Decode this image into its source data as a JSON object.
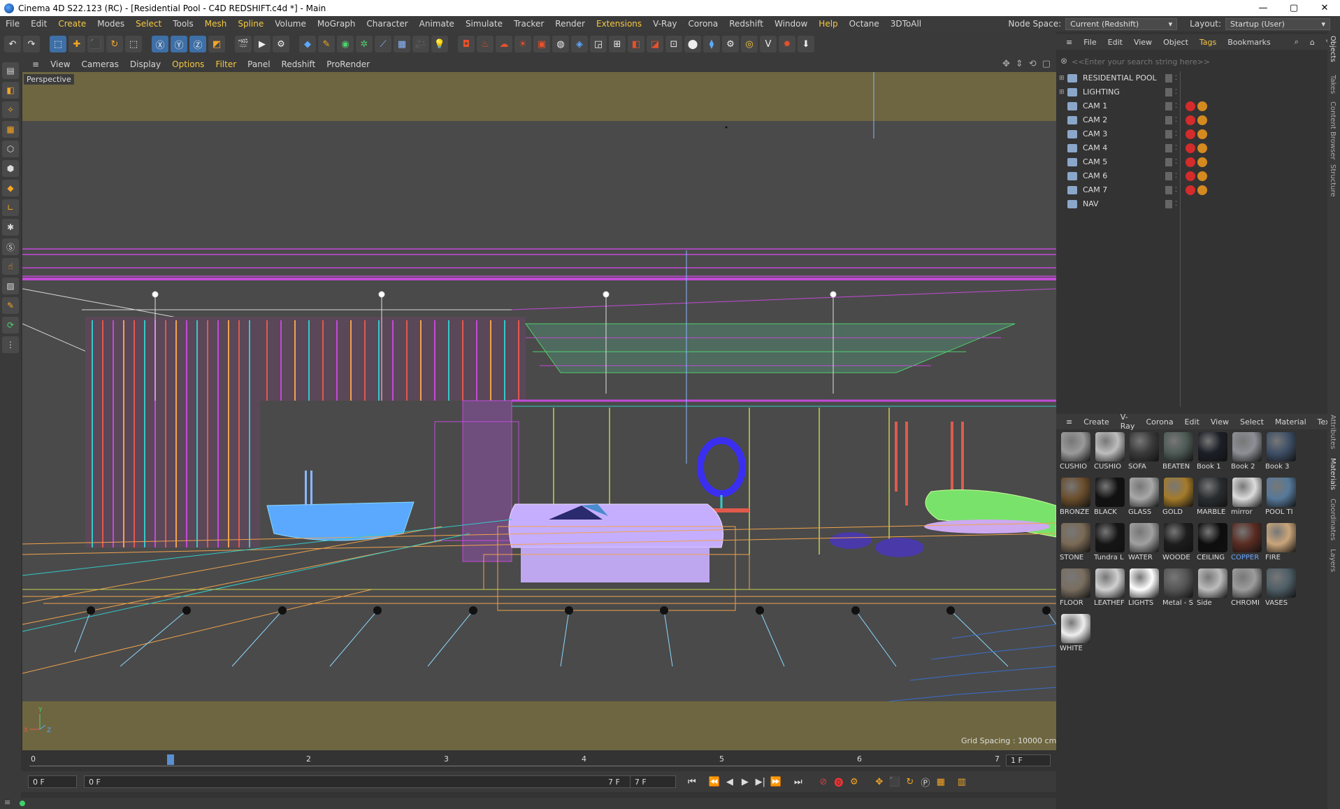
{
  "window": {
    "title": "Cinema 4D S22.123 (RC) - [Residential Pool - C4D REDSHIFT.c4d *] - Main",
    "buttons": [
      "—",
      "▢",
      "✕"
    ]
  },
  "menubar": {
    "items": [
      "File",
      "Edit",
      "Create",
      "Modes",
      "Select",
      "Tools",
      "Mesh",
      "Spline",
      "Volume",
      "MoGraph",
      "Character",
      "Animate",
      "Simulate",
      "Tracker",
      "Render",
      "Extensions",
      "V-Ray",
      "Corona",
      "Redshift",
      "Window",
      "Help",
      "Octane",
      "3DToAll"
    ],
    "node_space_label": "Node Space:",
    "node_space_value": "Current (Redshift)",
    "layout_label": "Layout:",
    "layout_value": "Startup (User)"
  },
  "viewport_menu": {
    "items": [
      "View",
      "Cameras",
      "Display",
      "Options",
      "Filter",
      "Panel",
      "Redshift",
      "ProRender"
    ]
  },
  "viewport": {
    "label": "Perspective",
    "grid_spacing": "Grid Spacing : 10000 cm"
  },
  "timeline": {
    "ticks": [
      "0",
      "1",
      "2",
      "3",
      "4",
      "5",
      "6",
      "7"
    ],
    "current_frame": "1 F"
  },
  "transport": {
    "start_frame": "0 F",
    "min_frame": "0 F",
    "end_frame": "7 F",
    "max_frame": "7 F"
  },
  "object_manager": {
    "menu": [
      "File",
      "Edit",
      "View",
      "Object",
      "Tags",
      "Bookmarks"
    ],
    "search_placeholder": "<<Enter your search string here>>",
    "objects": [
      {
        "name": "RESIDENTIAL POOL",
        "tags": []
      },
      {
        "name": "LIGHTING",
        "tags": []
      },
      {
        "name": "CAM 1",
        "tags": [
          "red",
          "orange"
        ]
      },
      {
        "name": "CAM 2",
        "tags": [
          "red",
          "orange"
        ]
      },
      {
        "name": "CAM 3",
        "tags": [
          "red",
          "orange"
        ]
      },
      {
        "name": "CAM 4",
        "tags": [
          "red",
          "orange"
        ]
      },
      {
        "name": "CAM 5",
        "tags": [
          "red",
          "orange"
        ]
      },
      {
        "name": "CAM 6",
        "tags": [
          "red",
          "orange"
        ]
      },
      {
        "name": "CAM 7",
        "tags": [
          "red",
          "orange"
        ]
      },
      {
        "name": "NAV",
        "tags": []
      }
    ]
  },
  "material_manager": {
    "menu": [
      "Create",
      "V-Ray",
      "Corona",
      "Edit",
      "View",
      "Select",
      "Material",
      "Textu"
    ],
    "materials": [
      {
        "name": "CUSHIO",
        "color": "#9a9a9a"
      },
      {
        "name": "CUSHIO",
        "color": "#bdbdbd"
      },
      {
        "name": "SOFA",
        "color": "#3a3a3a"
      },
      {
        "name": "BEATEN",
        "color": "#4d5a55"
      },
      {
        "name": "Book 1",
        "color": "#1c1f27"
      },
      {
        "name": "Book 2",
        "color": "#8d8f95"
      },
      {
        "name": "Book 3",
        "color": "#3e4f66"
      },
      {
        "name": "BRONZE",
        "color": "#6b4e2c"
      },
      {
        "name": "BLACK",
        "color": "#111111"
      },
      {
        "name": "GLASS",
        "color": "#a8a8a8"
      },
      {
        "name": "GOLD",
        "color": "#a57b2a"
      },
      {
        "name": "MARBLE",
        "color": "#2a2d30"
      },
      {
        "name": "mirror",
        "color": "#dcdcdc"
      },
      {
        "name": "POOL TI",
        "color": "#56799a"
      },
      {
        "name": "STONE",
        "color": "#7a6a55"
      },
      {
        "name": "Tundra L",
        "color": "#151515"
      },
      {
        "name": "WATER",
        "color": "#a0a0a0"
      },
      {
        "name": "WOODE",
        "color": "#1d1d1d"
      },
      {
        "name": "CEILING",
        "color": "#0d0d0d"
      },
      {
        "name": "COPPER",
        "color": "#5a2c22"
      },
      {
        "name": "FIRE",
        "color": "#c9a57a"
      },
      {
        "name": "FLOOR",
        "color": "#7a6e60"
      },
      {
        "name": "LEATHEF",
        "color": "#d0d0d0"
      },
      {
        "name": "LIGHTS",
        "color": "#ffffff"
      },
      {
        "name": "Metal - S",
        "color": "#555555"
      },
      {
        "name": "Side",
        "color": "#bcbcbc"
      },
      {
        "name": "CHROMI",
        "color": "#9c9c9c"
      },
      {
        "name": "VASES",
        "color": "#4e5e66"
      },
      {
        "name": "WHITE",
        "color": "#eeeeee"
      }
    ],
    "selected": "COPPER"
  },
  "side_tabs": [
    "Objects",
    "Takes",
    "Content Browser",
    "Structure",
    "Attributes",
    "Materials",
    "Coordinates",
    "Layers"
  ]
}
